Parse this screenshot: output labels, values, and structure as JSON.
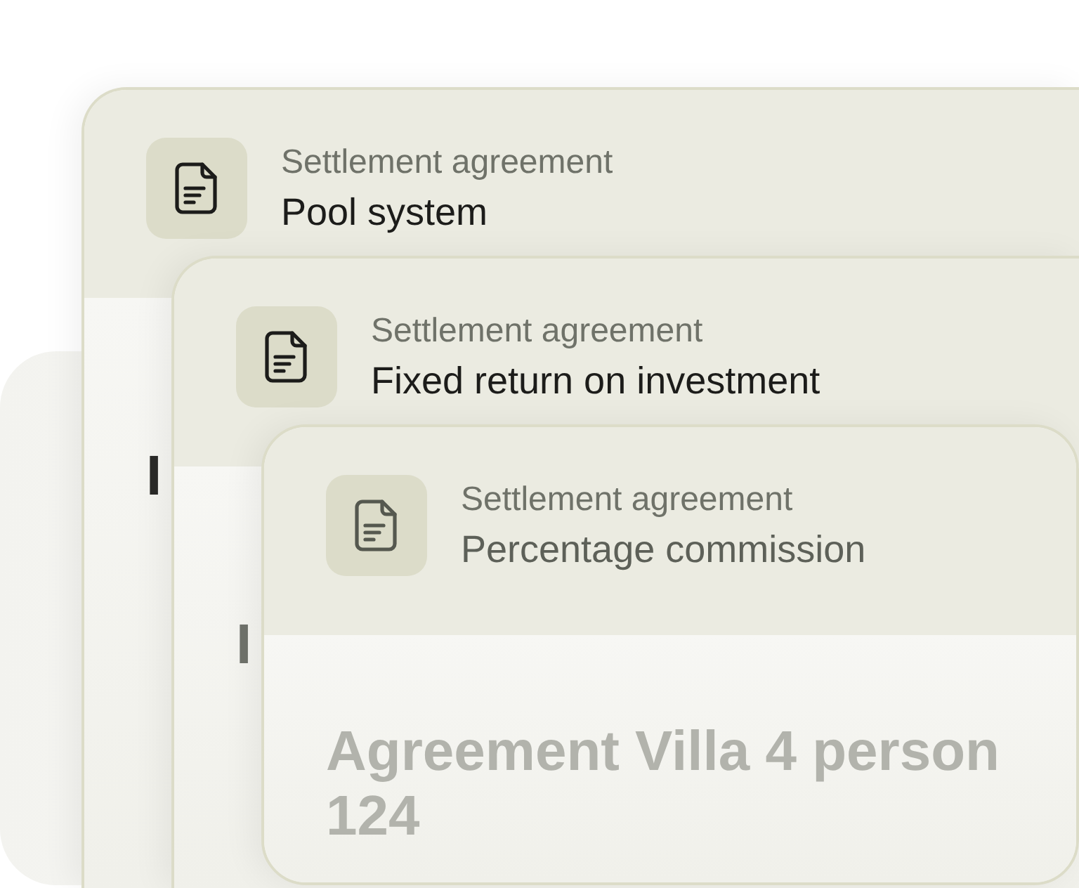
{
  "cards": [
    {
      "label": "Settlement agreement",
      "title": "Pool system",
      "body_lines": [
        "I"
      ]
    },
    {
      "label": "Settlement agreement",
      "title": "Fixed return on investment",
      "body_lines": [
        "I"
      ]
    },
    {
      "label": "Settlement agreement",
      "title": "Percentage commission",
      "body_lines": [
        "Agreement Villa 4 person",
        "124"
      ]
    }
  ]
}
